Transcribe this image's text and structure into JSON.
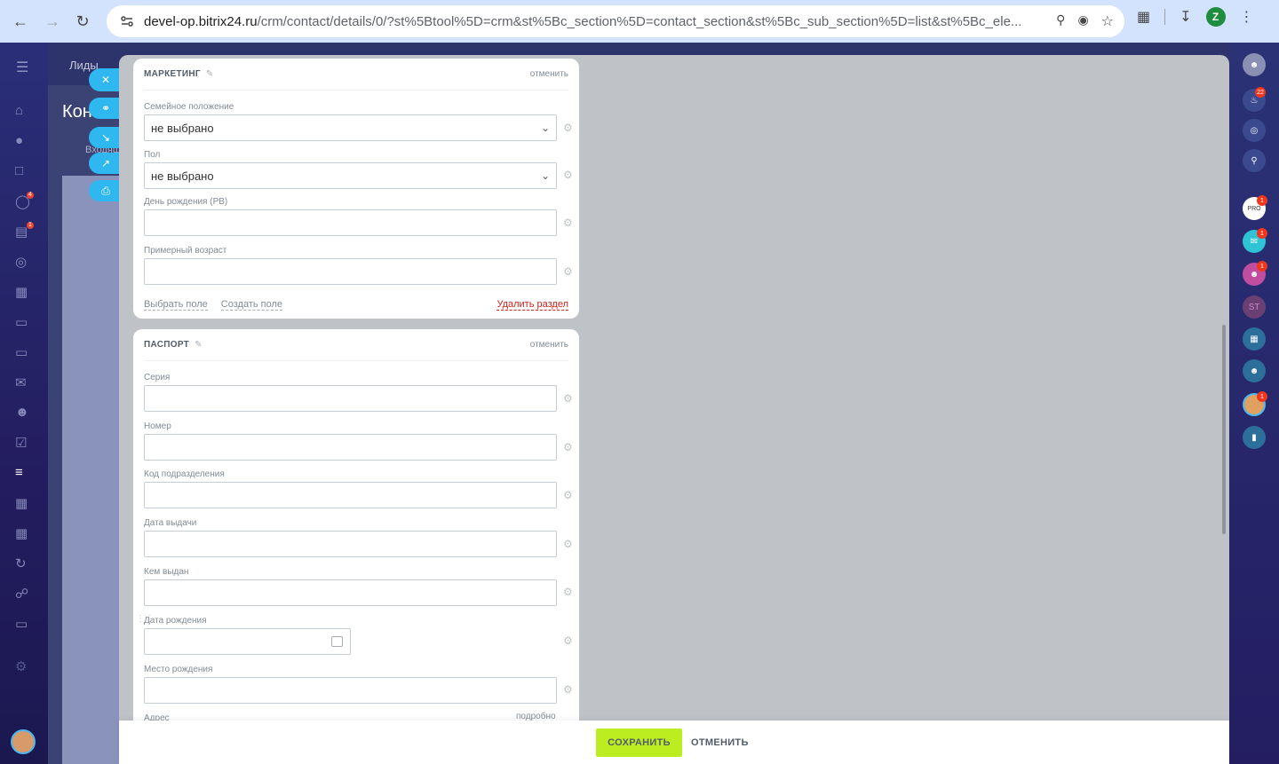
{
  "browser": {
    "domain": "devel-op.bitrix24.ru",
    "path": "/crm/contact/details/0/?st%5Btool%5D=crm&st%5Bc_section%5D=contact_section&st%5Bc_sub_section%5D=list&st%5Bc_ele...",
    "profile_initial": "Z"
  },
  "background": {
    "tab_leads": "Лиды",
    "page_title": "Кон",
    "incoming": "Входящ"
  },
  "marketing": {
    "title": "МАРКЕТИНГ",
    "cancel": "отменить",
    "fields": [
      {
        "label": "Семейное положение",
        "value": "не выбрано"
      },
      {
        "label": "Пол",
        "value": "не выбрано"
      },
      {
        "label": "День рождения (РВ)",
        "value": ""
      },
      {
        "label": "Примерный возраст",
        "value": ""
      }
    ],
    "select_field": "Выбрать поле",
    "create_field": "Создать поле",
    "delete_section": "Удалить раздел"
  },
  "passport": {
    "title": "ПАСПОРТ",
    "cancel": "отменить",
    "fields": [
      {
        "label": "Серия",
        "value": ""
      },
      {
        "label": "Номер",
        "value": ""
      },
      {
        "label": "Код подразделения",
        "value": ""
      },
      {
        "label": "Дата выдачи",
        "value": ""
      },
      {
        "label": "Кем выдан",
        "value": ""
      },
      {
        "label": "Дата рождения",
        "value": ""
      },
      {
        "label": "Место рождения",
        "value": ""
      },
      {
        "label": "Адрес",
        "value": ""
      }
    ],
    "address_details": "подробно"
  },
  "actions": {
    "save": "СОХРАНИТЬ",
    "cancel": "ОТМЕНИТЬ"
  },
  "right_bar": {
    "notifications_count": "22",
    "badge_one": "1",
    "st_initials": "ST"
  },
  "left_bar": {
    "badge_4": "4",
    "badge_1": "1"
  },
  "colors": {
    "accent_green": "#bbed21",
    "link_red": "#d0211a",
    "quick_btn_blue": "#2fb7f0"
  }
}
